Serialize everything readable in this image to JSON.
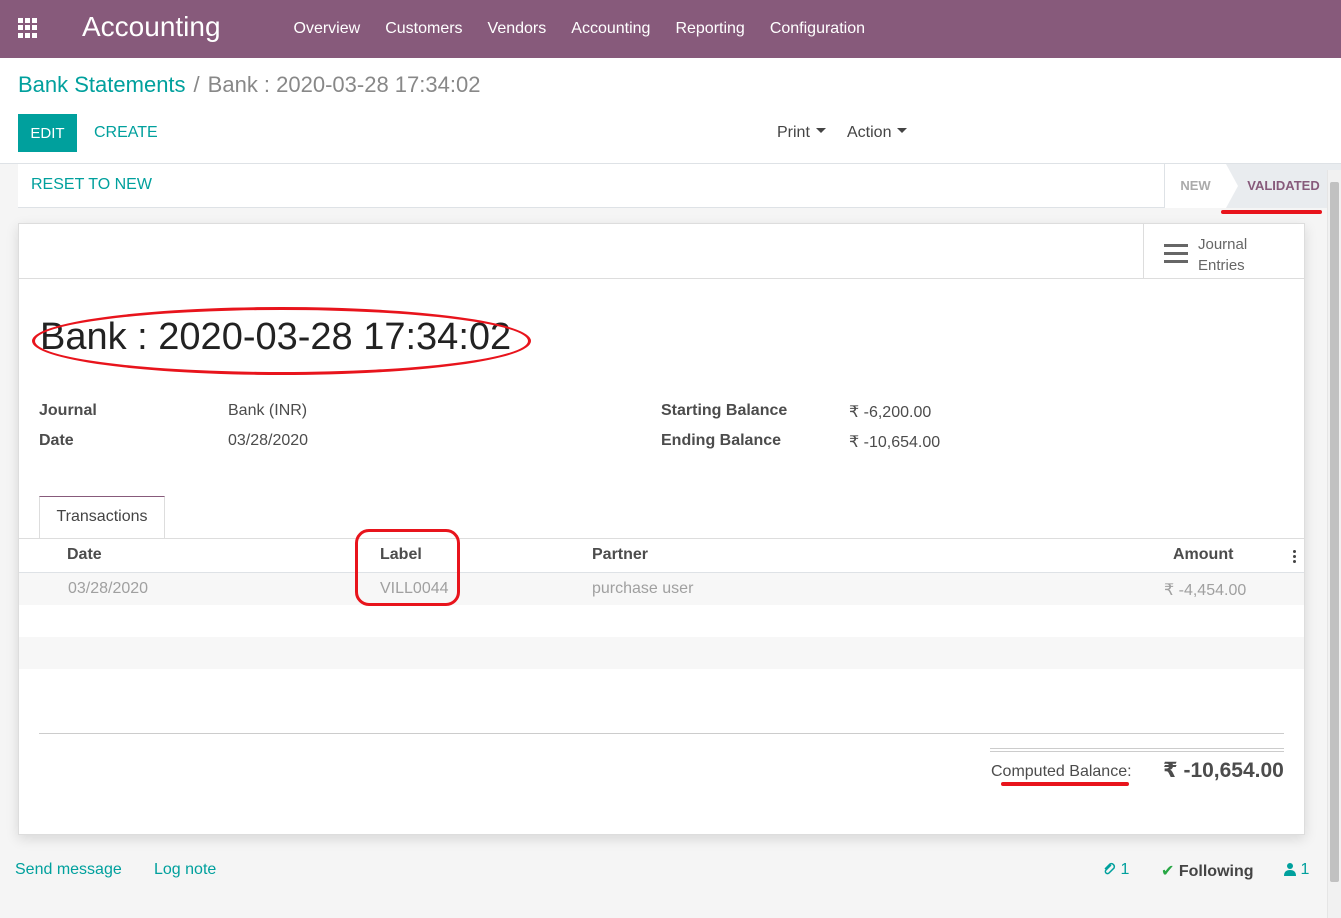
{
  "navbar": {
    "apps_icon": "grid-icon",
    "brand": "Accounting",
    "menu": [
      "Overview",
      "Customers",
      "Vendors",
      "Accounting",
      "Reporting",
      "Configuration"
    ],
    "color": "#875a7b"
  },
  "breadcrumb": {
    "parent": "Bank Statements",
    "separator": "/",
    "current": "Bank : 2020-03-28 17:34:02"
  },
  "toolbar": {
    "edit_label": "EDIT",
    "create_label": "CREATE",
    "print_label": "Print",
    "action_label": "Action"
  },
  "statusbar": {
    "reset_label": "RESET TO NEW",
    "stages": [
      "NEW",
      "VALIDATED"
    ],
    "active_stage": "VALIDATED"
  },
  "smart_button": {
    "icon": "list-icon",
    "line1": "Journal",
    "line2": "Entries"
  },
  "record": {
    "title": "Bank : 2020-03-28 17:34:02",
    "journal_label": "Journal",
    "journal_value": "Bank (INR)",
    "date_label": "Date",
    "date_value": "03/28/2020",
    "starting_label": "Starting Balance",
    "starting_value": "₹ -6,200.00",
    "ending_label": "Ending Balance",
    "ending_value": "₹ -10,654.00"
  },
  "tabs": [
    "Transactions"
  ],
  "table": {
    "headers": [
      "Date",
      "Label",
      "Partner",
      "Amount"
    ],
    "rows": [
      [
        "03/28/2020",
        "VILL0044",
        "purchase user",
        "₹ -4,454.00"
      ]
    ]
  },
  "totals": {
    "label": "Computed Balance:",
    "value": "₹ -10,654.00"
  },
  "chatter": {
    "send_message": "Send message",
    "log_note": "Log note",
    "attachments": "1",
    "following": "Following",
    "followers": "1"
  },
  "annotation_color": "#e8141c"
}
